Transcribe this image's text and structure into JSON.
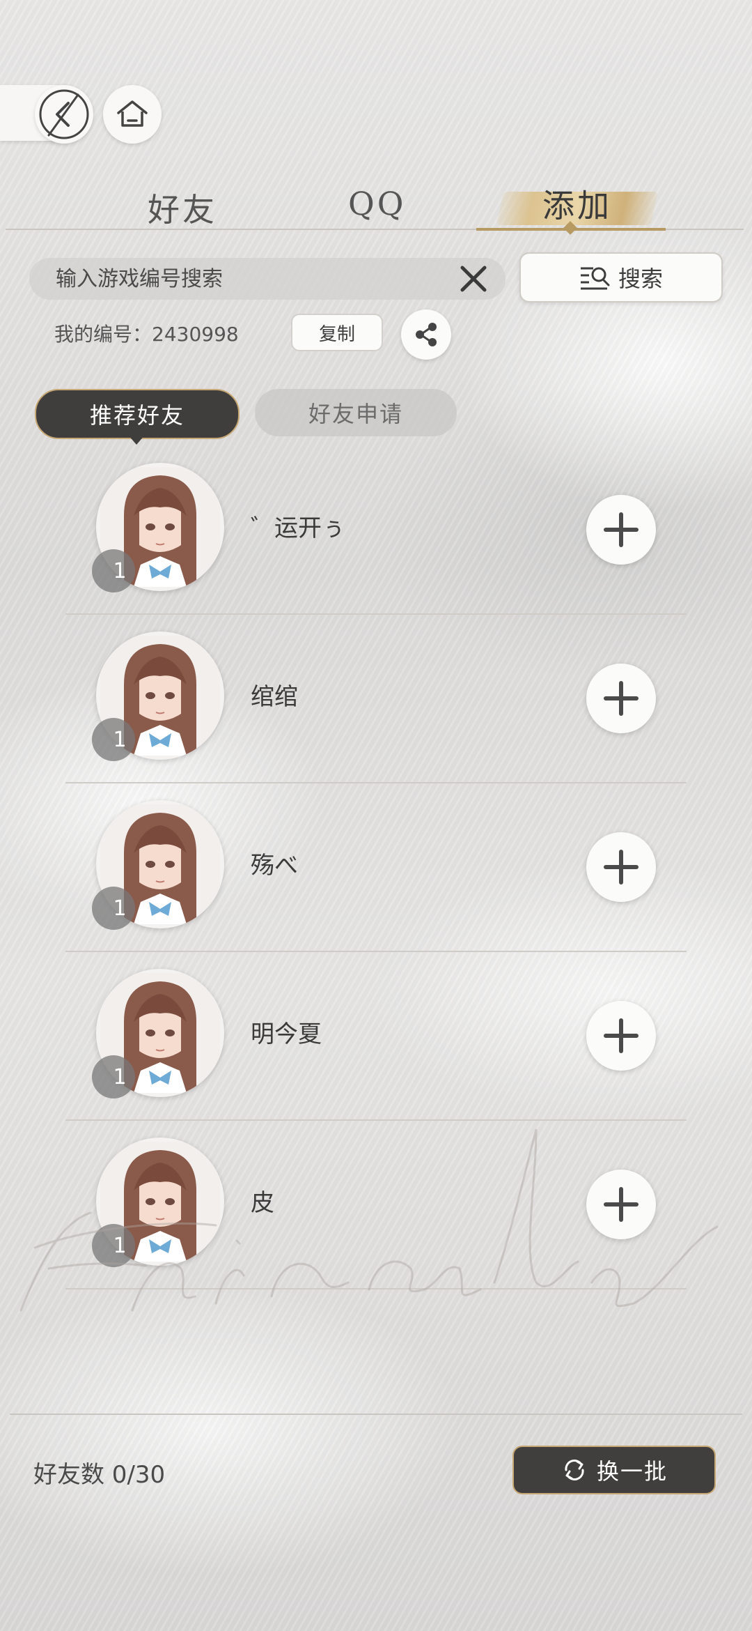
{
  "nav": {
    "back_icon": "back-arrow-icon",
    "home_icon": "home-icon"
  },
  "tabs": [
    {
      "label": "好友",
      "active": false
    },
    {
      "label": "QQ",
      "active": false
    },
    {
      "label": "添加",
      "active": true
    }
  ],
  "search": {
    "placeholder": "输入游戏编号搜索",
    "value": "",
    "clear_icon": "close-icon",
    "button_label": "搜索",
    "button_icon": "search-list-icon"
  },
  "my_id": {
    "text": "我的编号：2430998",
    "copy_label": "复制",
    "share_icon": "share-icon"
  },
  "subtabs": [
    {
      "label": "推荐好友",
      "active": true
    },
    {
      "label": "好友申请",
      "active": false
    }
  ],
  "friends": [
    {
      "name": "゛运开ぅ",
      "level": "1"
    },
    {
      "name": "绾绾",
      "level": "1"
    },
    {
      "name": "殇べ",
      "level": "1"
    },
    {
      "name": "明今夏",
      "level": "1"
    },
    {
      "name": "皮",
      "level": "1"
    }
  ],
  "footer": {
    "count_text": "好友数 0/30",
    "refresh_label": "换一批",
    "refresh_icon": "refresh-icon"
  },
  "colors": {
    "accent_gold": "#b79a62",
    "dark_button": "#403f3e"
  }
}
